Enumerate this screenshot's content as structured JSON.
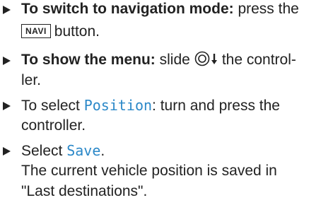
{
  "steps": [
    {
      "lead_bold": "To switch to navigation mode:",
      "text_after_lead": " press the",
      "key_label": "NAVI",
      "text_after_key": "button."
    },
    {
      "lead_bold": "To show the menu:",
      "text_before_icon": " slide",
      "icon": "controller-slide-down-icon",
      "text_after_icon": "the control-",
      "continuation": "ler."
    },
    {
      "text_before_term": "To select ",
      "term": "Position",
      "text_after_term": ": turn and press the",
      "continuation": "controller."
    },
    {
      "text_before_term": "Select ",
      "term": "Save",
      "text_after_term": ".",
      "result_line1": "The current vehicle position is saved in",
      "result_line2": "\"Last destinations\"."
    }
  ],
  "colors": {
    "text": "#222222",
    "ui_term": "#2b88c8"
  }
}
